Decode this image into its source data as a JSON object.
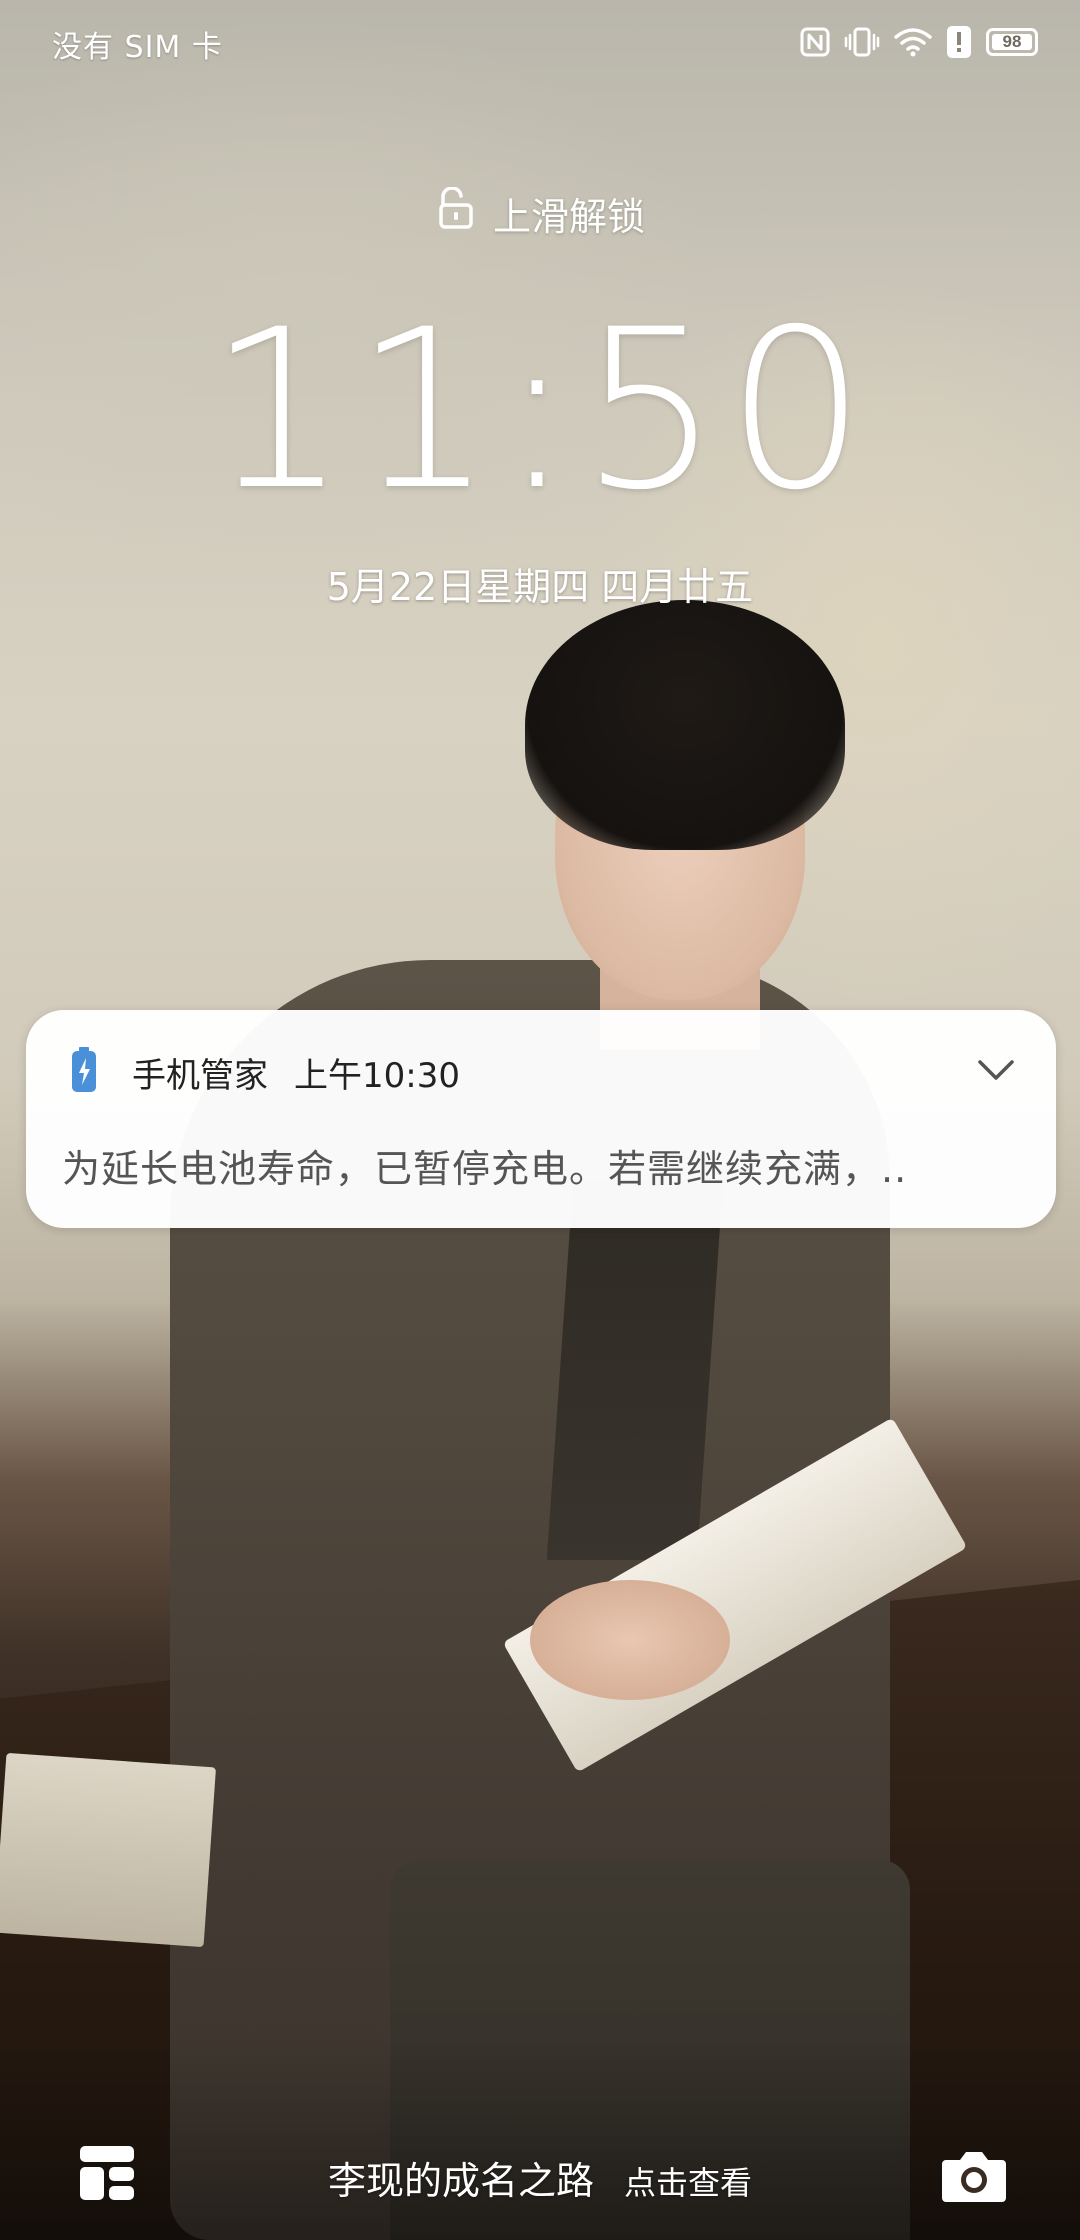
{
  "status_bar": {
    "carrier": "没有 SIM 卡",
    "battery_level": "98",
    "icons": [
      "nfc-icon",
      "vibrate-icon",
      "wifi-icon",
      "alert-icon",
      "battery-icon"
    ]
  },
  "lock": {
    "unlock_hint": "上滑解锁",
    "time": "11:50",
    "date": "5月22日星期四  四月廿五"
  },
  "notification": {
    "app_name": "手机管家",
    "time": "上午10:30",
    "body": "为延长电池寿命，已暂停充电。若需继续充满，.."
  },
  "bottom_bar": {
    "magazine_title": "李现的成名之路",
    "magazine_action": "点击查看"
  },
  "colors": {
    "text_on_wallpaper": "#ffffff",
    "notification_bg": "#ffffff",
    "battery_icon_accent": "#4a90d9"
  }
}
